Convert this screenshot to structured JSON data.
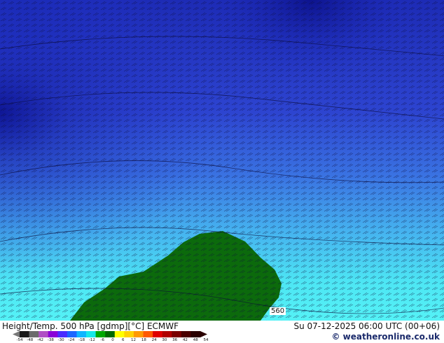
{
  "map": {
    "contour_labels": [
      "560"
    ],
    "colors": {
      "deep_blue": "#0b0f8c",
      "blue": "#2233cc",
      "mid_blue": "#3f66e0",
      "light_blue": "#4aa8f0",
      "cyan": "#4df0f5",
      "green": "#0c6a0c",
      "glyph_line": "#0a0a38"
    }
  },
  "footer": {
    "title": "Height/Temp. 500 hPa [gdmp][°C] ECMWF",
    "datetime": "Su 07-12-2025 06:00 UTC (00+06)",
    "credit": "© weatheronline.co.uk"
  },
  "legend": {
    "ticks": [
      "-54",
      "-48",
      "-42",
      "-38",
      "-30",
      "-24",
      "-18",
      "-12",
      "-6",
      "0",
      "6",
      "12",
      "18",
      "24",
      "30",
      "36",
      "42",
      "48",
      "54"
    ],
    "colors": [
      "#1a1a1a",
      "#6b6b6b",
      "#b04fc4",
      "#8a00d8",
      "#4a2bff",
      "#1b66ff",
      "#0fb5ff",
      "#17e8e8",
      "#00a800",
      "#006800",
      "#ffff00",
      "#ffd200",
      "#ff9a00",
      "#ff5a00",
      "#e00000",
      "#b00000",
      "#7a0000",
      "#4a0000",
      "#2a0000"
    ]
  }
}
